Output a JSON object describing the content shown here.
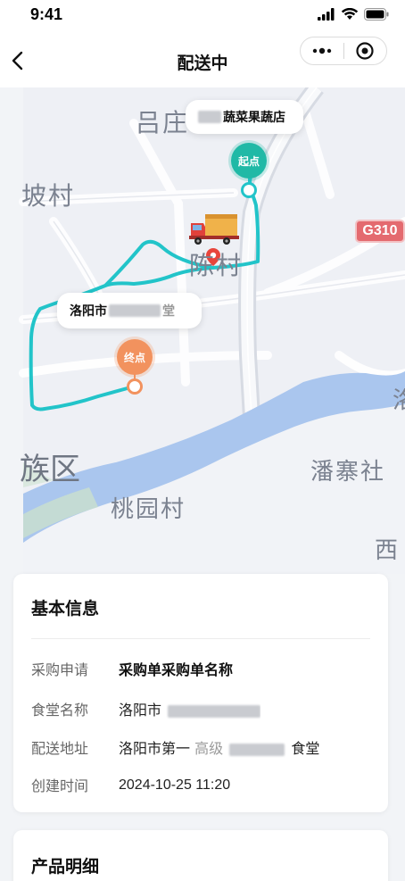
{
  "status_bar": {
    "time": "9:41"
  },
  "nav": {
    "title": "配送中"
  },
  "map": {
    "places": {
      "lvzhuang": "吕庄",
      "pocun": "坡村",
      "chencun": "陈村",
      "zuqu": "族区",
      "taoyuancun": "桃园村",
      "panzhai": "潘寨社",
      "xi": "西",
      "right_edge": "洛"
    },
    "highway_badge": "G310",
    "start_bubble_suffix": "蔬菜果蔬店",
    "end_bubble_prefix": "洛阳市",
    "end_bubble_suffix": "堂",
    "start_label": "起点",
    "end_label": "终点",
    "route_color": "#22c4c9",
    "start_color": "#20b9a6",
    "end_color": "#f2925e"
  },
  "basic_info": {
    "title": "基本信息",
    "rows": [
      {
        "label": "采购申请",
        "value": "采购单采购单名称"
      },
      {
        "label": "食堂名称",
        "value": "洛阳市"
      },
      {
        "label": "配送地址",
        "value": "洛阳市第一",
        "value_tail": "高级",
        "value_end": "食堂"
      },
      {
        "label": "创建时间",
        "value": "2024-10-25 11:20"
      }
    ]
  },
  "product_detail": {
    "title": "产品明细"
  }
}
